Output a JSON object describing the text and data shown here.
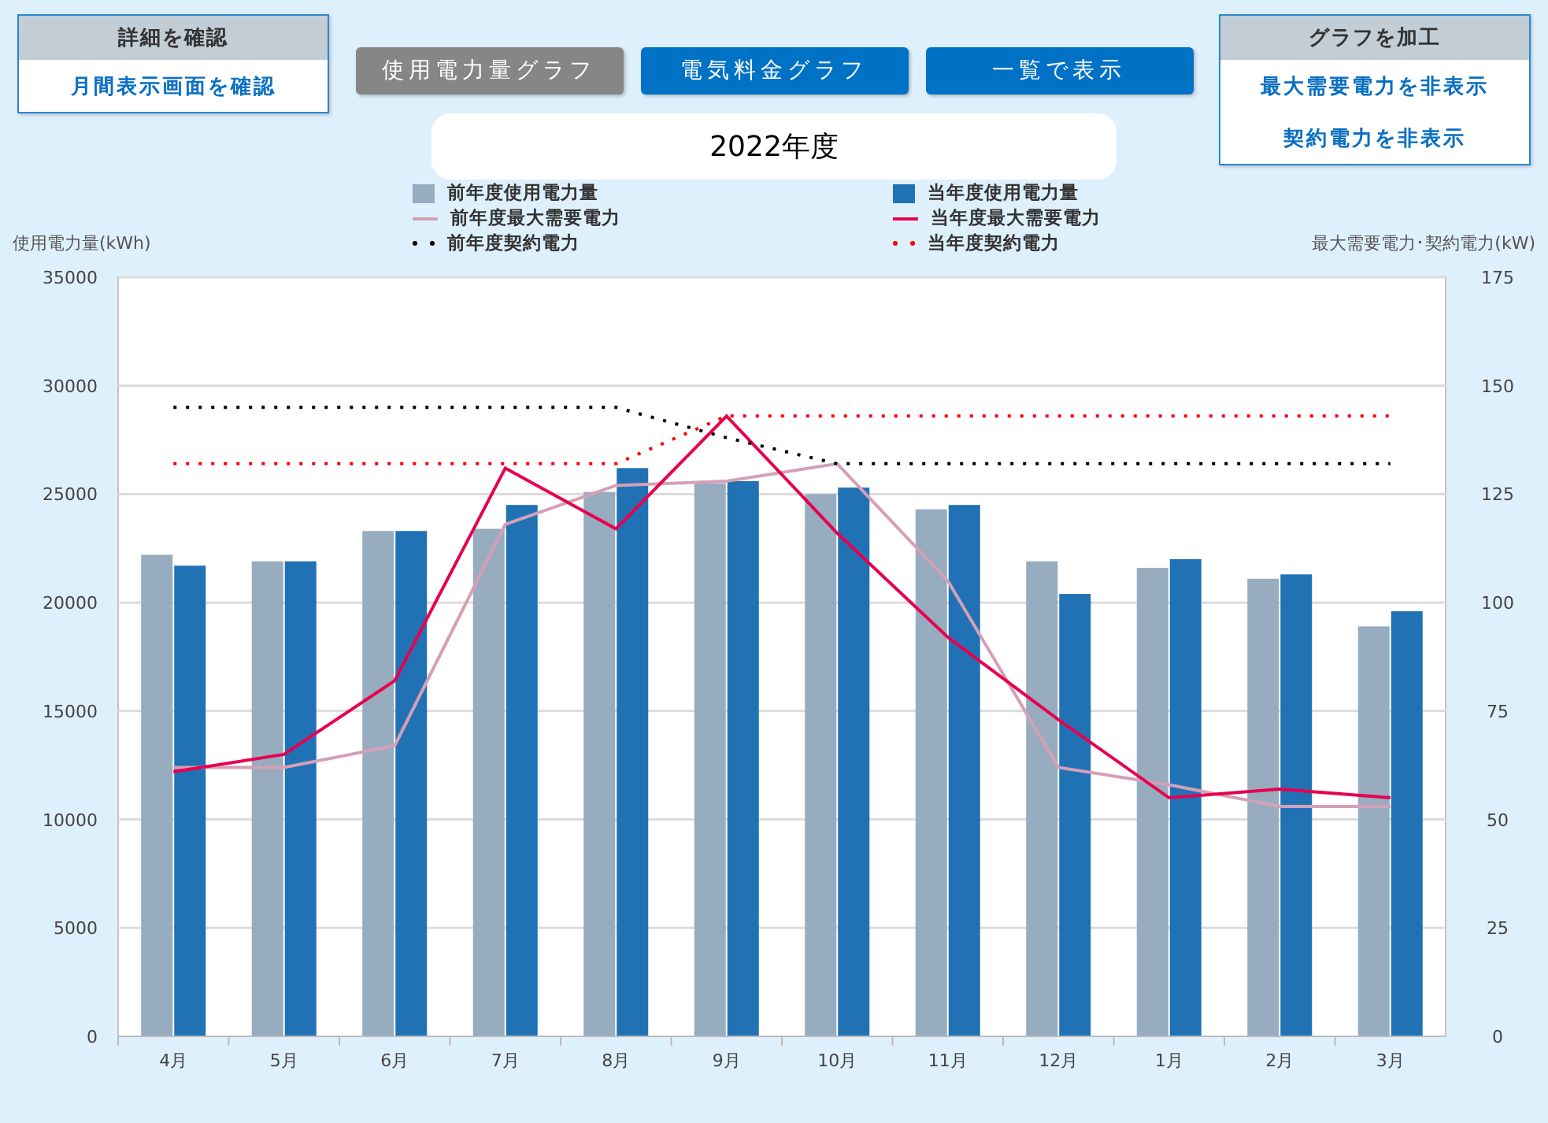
{
  "detail_panel": {
    "header": "詳細を確認",
    "links": [
      "月間表示画面を確認"
    ]
  },
  "graph_tabs": [
    {
      "label": "使用電力量グラフ",
      "selected": true
    },
    {
      "label": "電気料金グラフ",
      "selected": false
    },
    {
      "label": "一覧で表示",
      "selected": false
    }
  ],
  "graph_options": {
    "header": "グラフを加工",
    "links": [
      "最大需要電力を非表示",
      "契約電力を非表示"
    ]
  },
  "fiscal_year": "2022年度",
  "chart_data": {
    "type": "bar",
    "stacked": false,
    "grid": true,
    "ylabel": "使用電力量(kWh)",
    "y2label": "最大需要電力･契約電力(kW)",
    "categories": [
      "4月",
      "5月",
      "6月",
      "7月",
      "8月",
      "9月",
      "10月",
      "11月",
      "12月",
      "1月",
      "2月",
      "3月"
    ],
    "ylim": [
      0,
      35000
    ],
    "yticks": [
      0,
      5000,
      10000,
      15000,
      20000,
      25000,
      30000,
      35000
    ],
    "y2lim": [
      0,
      175
    ],
    "y2ticks": [
      0,
      25,
      50,
      75,
      100,
      125,
      150,
      175
    ],
    "series": [
      {
        "name": "前年度使用電力量",
        "type": "bar",
        "color": "#97acbf",
        "values": [
          22200,
          21900,
          23300,
          23400,
          25100,
          25500,
          25000,
          24300,
          21900,
          21600,
          21100,
          18900
        ]
      },
      {
        "name": "当年度使用電力量",
        "type": "bar",
        "color": "#2172b4",
        "values": [
          21700,
          21900,
          23300,
          24500,
          26200,
          25600,
          25300,
          24500,
          20400,
          22000,
          21300,
          19600
        ]
      },
      {
        "name": "前年度最大需要電力",
        "type": "line",
        "axis": "y2",
        "color": "#d4a0b8",
        "values": [
          62,
          62,
          67,
          118,
          127,
          128,
          132,
          105,
          62,
          58,
          53,
          53
        ]
      },
      {
        "name": "当年度最大需要電力",
        "type": "line",
        "axis": "y2",
        "color": "#e8004f",
        "values": [
          61,
          65,
          82,
          131,
          117,
          143,
          116,
          92,
          73,
          55,
          57,
          55
        ]
      },
      {
        "name": "前年度契約電力",
        "type": "line",
        "line_style": "dotted",
        "axis": "y2",
        "color": "#000000",
        "values": [
          145,
          145,
          145,
          145,
          145,
          138,
          132,
          132,
          132,
          132,
          132,
          132
        ]
      },
      {
        "name": "当年度契約電力",
        "type": "line",
        "line_style": "dotted",
        "axis": "y2",
        "color": "#ff0000",
        "values": [
          132,
          132,
          132,
          132,
          132,
          143,
          143,
          143,
          143,
          143,
          143,
          143
        ]
      }
    ]
  }
}
